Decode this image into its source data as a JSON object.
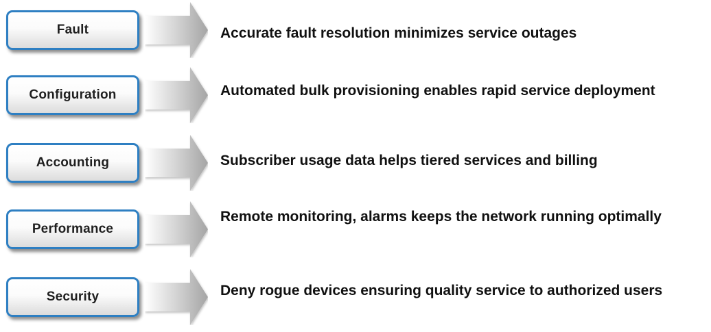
{
  "items": [
    {
      "label": "Fault",
      "description": "Accurate fault resolution minimizes service outages"
    },
    {
      "label": "Configuration",
      "description": "Automated bulk provisioning enables rapid service deployment"
    },
    {
      "label": "Accounting",
      "description": "Subscriber usage data helps tiered services and billing"
    },
    {
      "label": "Performance",
      "description": "Remote monitoring, alarms keeps the network running optimally"
    },
    {
      "label": "Security",
      "description": "Deny rogue devices ensuring quality service to authorized users"
    }
  ],
  "colors": {
    "box_border": "#2e7fc2",
    "text": "#111111",
    "arrow_light": "#ffffff",
    "arrow_dark": "#a4a4a4"
  }
}
